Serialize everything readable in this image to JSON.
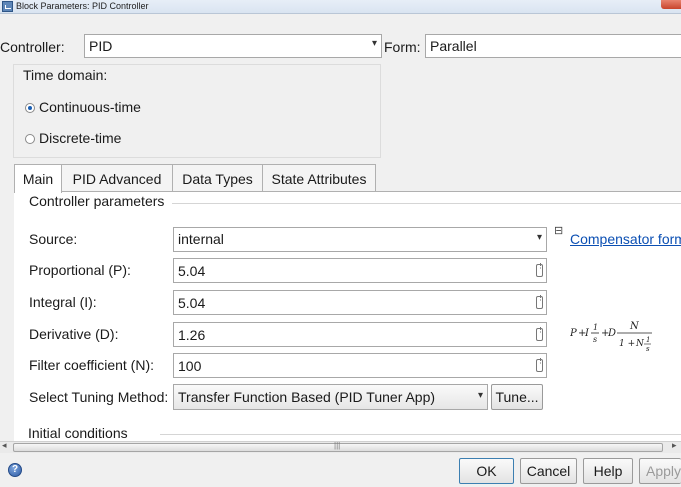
{
  "window": {
    "title": "Block Parameters: PID Controller"
  },
  "controller": {
    "label": "Controller:",
    "value": "PID"
  },
  "form": {
    "label": "Form:",
    "value": "Parallel"
  },
  "time_domain": {
    "title": "Time domain:",
    "options": [
      {
        "label": "Continuous-time",
        "checked": true
      },
      {
        "label": "Discrete-time",
        "checked": false
      }
    ]
  },
  "tabs": [
    {
      "label": "Main",
      "active": true
    },
    {
      "label": "PID Advanced",
      "active": false
    },
    {
      "label": "Data Types",
      "active": false
    },
    {
      "label": "State Attributes",
      "active": false
    }
  ],
  "main": {
    "section_title": "Controller parameters",
    "source": {
      "label": "Source:",
      "value": "internal"
    },
    "compensator_link": "Compensator form",
    "params": [
      {
        "label": "Proportional (P):",
        "value": "5.04"
      },
      {
        "label": "Integral (I):",
        "value": "5.04"
      },
      {
        "label": "Derivative (D):",
        "value": "1.26"
      },
      {
        "label": "Filter coefficient (N):",
        "value": "100"
      }
    ],
    "tuning": {
      "label": "Select Tuning Method:",
      "value": "Transfer Function Based (PID Tuner App)",
      "tune_button": "Tune..."
    },
    "initial_conditions_title": "Initial conditions"
  },
  "formula": {
    "p": "P",
    "plus1": "+",
    "i": "I",
    "one": "1",
    "s": "s",
    "plus2": "+",
    "d": "D",
    "n": "N",
    "den_prefix": "1 +",
    "n2": "N",
    "one2": "1",
    "s2": "s"
  },
  "footer": {
    "ok": "OK",
    "cancel": "Cancel",
    "help": "Help",
    "apply": "Apply"
  }
}
